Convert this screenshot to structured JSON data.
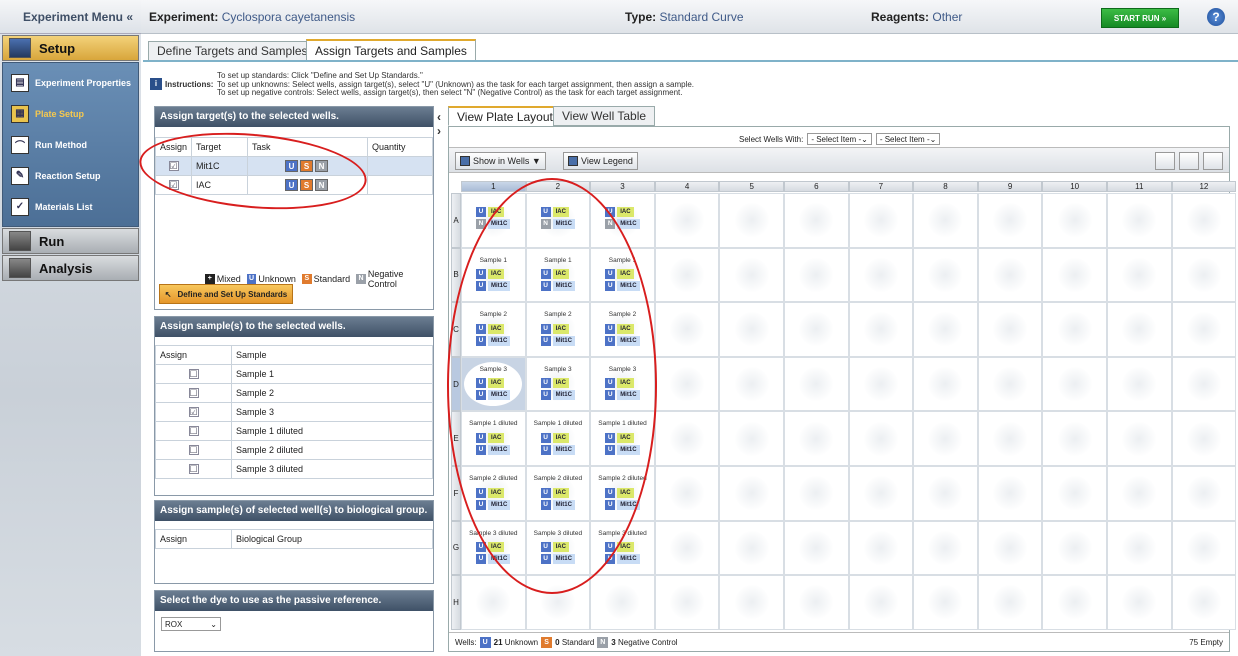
{
  "menu": {
    "title": "Experiment Menu «",
    "setup": "Setup",
    "items": [
      "Experiment Properties",
      "Plate Setup",
      "Run Method",
      "Reaction Setup",
      "Materials List"
    ],
    "run": "Run",
    "analysis": "Analysis"
  },
  "header": {
    "exp_label": "Experiment:",
    "exp_name": "Cyclospora cayetanensis",
    "type_label": "Type:",
    "type_value": "Standard Curve",
    "reag_label": "Reagents:",
    "reag_value": "Other",
    "start": "START RUN »",
    "help": "?"
  },
  "tabs": [
    "Define Targets and Samples",
    "Assign Targets and Samples"
  ],
  "instructions": {
    "label": "Instructions:",
    "lines": [
      "To set up standards: Click \"Define and Set Up Standards.\"",
      "To set up unknowns: Select wells, assign target(s), select \"U\" (Unknown) as the task for each target assignment, then assign a sample.",
      "To set up negative controls: Select wells, assign target(s), then select \"N\" (Negative Control) as the task for each target assignment."
    ]
  },
  "targets_panel": {
    "title": "Assign target(s) to the selected wells.",
    "cols": [
      "Assign",
      "Target",
      "Task",
      "Quantity"
    ],
    "rows": [
      {
        "check": "☑",
        "name": "Mit1C"
      },
      {
        "check": "☑",
        "name": "IAC"
      }
    ],
    "legend": [
      "Mixed",
      "Unknown",
      "Standard",
      "Negative Control"
    ],
    "define_btn": "Define and Set Up Standards"
  },
  "samples_panel": {
    "title": "Assign sample(s) to the selected wells.",
    "cols": [
      "Assign",
      "Sample"
    ],
    "rows": [
      {
        "check": "☐",
        "name": "Sample 1"
      },
      {
        "check": "☐",
        "name": "Sample 2"
      },
      {
        "check": "☑",
        "name": "Sample 3"
      },
      {
        "check": "☐",
        "name": "Sample 1 diluted"
      },
      {
        "check": "☐",
        "name": "Sample 2 diluted"
      },
      {
        "check": "☐",
        "name": "Sample 3 diluted"
      }
    ]
  },
  "bio_panel": {
    "title": "Assign sample(s) of selected well(s) to biological group.",
    "cols": [
      "Assign",
      "Biological Group"
    ]
  },
  "dye_panel": {
    "title": "Select the dye to use as the passive reference.",
    "value": "ROX"
  },
  "view_tabs": [
    "View Plate Layout",
    "View Well Table"
  ],
  "select_wells": {
    "label": "Select Wells With:",
    "opt1": "- Select Item -",
    "opt2": "- Select Item -"
  },
  "toolbar": {
    "show": "Show in Wells ▼",
    "legend": "View Legend"
  },
  "columns": [
    "1",
    "2",
    "3",
    "4",
    "5",
    "6",
    "7",
    "8",
    "9",
    "10",
    "11",
    "12"
  ],
  "rows": [
    "A",
    "B",
    "C",
    "D",
    "E",
    "F",
    "G",
    "H"
  ],
  "well_samples": [
    [
      "",
      "",
      ""
    ],
    [
      "Sample 1",
      "Sample 1",
      "Sample 1"
    ],
    [
      "Sample 2",
      "Sample 2",
      "Sample 2"
    ],
    [
      "Sample 3",
      "Sample 3",
      "Sample 3"
    ],
    [
      "Sample 1 diluted",
      "Sample 1 diluted",
      "Sample 1 diluted"
    ],
    [
      "Sample 2 diluted",
      "Sample 2 diluted",
      "Sample 2 diluted"
    ],
    [
      "Sample 3 diluted",
      "Sample 3 diluted",
      "Sample 3 diluted"
    ]
  ],
  "well_targets": {
    "a": "IAC",
    "b": "Mit1C"
  },
  "footer": {
    "wells": "Wells:",
    "u_count": "21",
    "u_label": "Unknown",
    "s_count": "0",
    "s_label": "Standard",
    "n_count": "3",
    "n_label": "Negative Control",
    "empty": "75 Empty"
  },
  "colors": {
    "unknown": "#4d72c6",
    "standard": "#e07b2e",
    "negative": "#9aa0a8",
    "annotation": "#d81e1e"
  }
}
